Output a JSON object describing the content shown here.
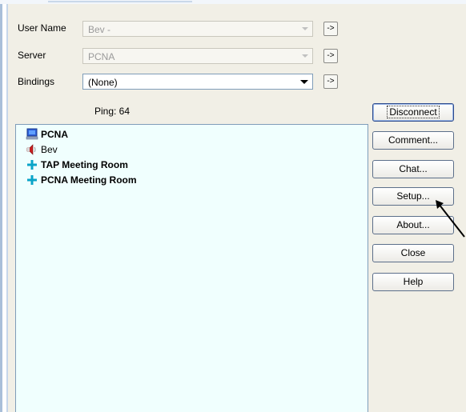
{
  "labels": {
    "user_name": "User Name",
    "server": "Server",
    "bindings": "Bindings",
    "ping": "Ping: 64"
  },
  "fields": {
    "user_name_value": "Bev -",
    "server_value": "PCNA",
    "bindings_value": "(None)",
    "go_label": "->"
  },
  "buttons": {
    "disconnect": "Disconnect",
    "comment": "Comment...",
    "chat": "Chat...",
    "setup": "Setup...",
    "about": "About...",
    "close": "Close",
    "help": "Help"
  },
  "tree": [
    {
      "label": "PCNA",
      "icon": "computer-icon",
      "bold": true
    },
    {
      "label": "Bev",
      "icon": "speaker-icon",
      "bold": false
    },
    {
      "label": "TAP Meeting Room",
      "icon": "plus-icon",
      "bold": true
    },
    {
      "label": "PCNA Meeting Room",
      "icon": "plus-icon",
      "bold": true
    }
  ]
}
